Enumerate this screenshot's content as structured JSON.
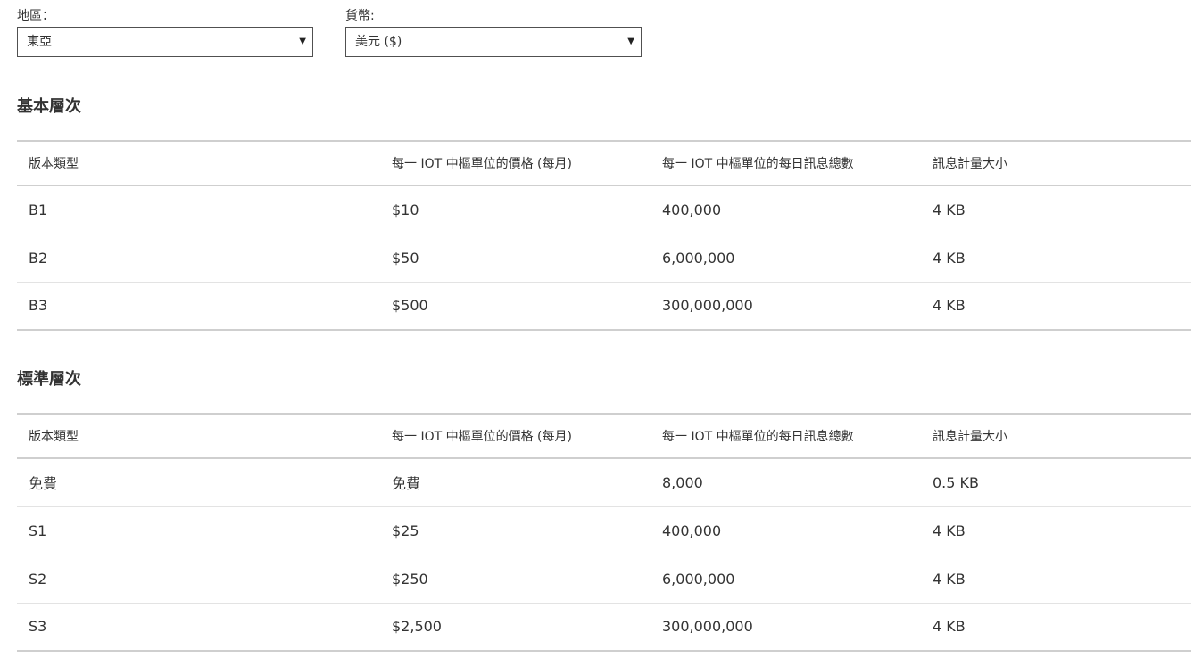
{
  "filters": {
    "region": {
      "label": "地區：",
      "selected": "東亞",
      "arrow_icon": "triangle-down-icon"
    },
    "currency": {
      "label": "貨幣:",
      "selected": "美元 ($)",
      "arrow_icon": "triangle-down-icon"
    }
  },
  "sections": [
    {
      "title": "基本層次",
      "columns": [
        "版本類型",
        "每一 IOT 中樞單位的價格 (每月)",
        "每一 IOT 中樞單位的每日訊息總數",
        "訊息計量大小"
      ],
      "rows": [
        [
          "B1",
          "$10",
          "400,000",
          "4 KB"
        ],
        [
          "B2",
          "$50",
          "6,000,000",
          "4 KB"
        ],
        [
          "B3",
          "$500",
          "300,000,000",
          "4 KB"
        ]
      ]
    },
    {
      "title": "標準層次",
      "columns": [
        "版本類型",
        "每一 IOT 中樞單位的價格 (每月)",
        "每一 IOT 中樞單位的每日訊息總數",
        "訊息計量大小"
      ],
      "rows": [
        [
          "免費",
          "免費",
          "8,000",
          "0.5 KB"
        ],
        [
          "S1",
          "$25",
          "400,000",
          "4 KB"
        ],
        [
          "S2",
          "$250",
          "6,000,000",
          "4 KB"
        ],
        [
          "S3",
          "$2,500",
          "300,000,000",
          "4 KB"
        ]
      ]
    }
  ]
}
